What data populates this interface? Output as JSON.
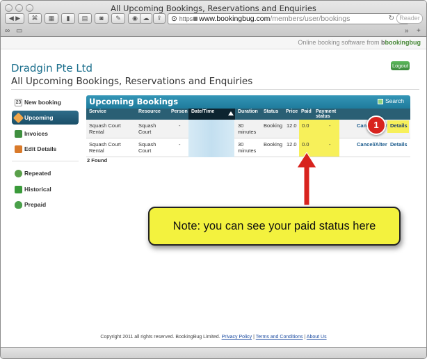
{
  "browser": {
    "window_title": "All Upcoming Bookings, Reservations and Enquiries",
    "url_scheme": "https",
    "url_host": "www.bookingbug.com",
    "url_path": "/members/user/bookings",
    "reader_label": "Reader",
    "overflow_label": "»",
    "add_label": "+"
  },
  "site_header": {
    "tagline": "Online booking software from",
    "brand_prefix": "b",
    "brand": "bookingbug"
  },
  "company_name": "Dradgin Pte Ltd",
  "logout_label": "Logout",
  "page_title": "All Upcoming Bookings, Reservations and Enquiries",
  "sidebar": {
    "items": [
      {
        "label": "New booking",
        "icon": "calendar-icon",
        "active": false
      },
      {
        "label": "Upcoming",
        "icon": "upcoming-icon",
        "active": true
      },
      {
        "label": "Invoices",
        "icon": "invoice-icon",
        "active": false
      },
      {
        "label": "Edit Details",
        "icon": "edit-icon",
        "active": false
      },
      {
        "label": "Repeated",
        "icon": "repeat-icon",
        "active": false
      },
      {
        "label": "Historical",
        "icon": "history-icon",
        "active": false
      },
      {
        "label": "Prepaid",
        "icon": "money-bag-icon",
        "active": false
      }
    ],
    "new_booking_day": "23"
  },
  "bookings": {
    "title": "Upcoming Bookings",
    "search_label": "Search",
    "columns": [
      "Service",
      "Resource",
      "Person",
      "Date/Time",
      "Duration",
      "Status",
      "Price",
      "Paid",
      "Payment status"
    ],
    "rows": [
      {
        "service": "Squash Court Rental",
        "resource": "Squash Court",
        "person": "-",
        "duration": "30 minutes",
        "status": "Booking",
        "price": "12.0",
        "paid": "0.0",
        "payment_status": "-",
        "action_cancel": "Cancel/Alter",
        "action_details": "Details"
      },
      {
        "service": "Squash Court Rental",
        "resource": "Squash Court",
        "person": "-",
        "duration": "30 minutes",
        "status": "Booking",
        "price": "12.0",
        "paid": "0.0",
        "payment_status": "-",
        "action_cancel": "Cancel/Alter",
        "action_details": "Details"
      }
    ],
    "found_text": "2 Found"
  },
  "annotation": {
    "badge_number": "1",
    "note_text": "Note: you can see your paid status here",
    "arrow_color": "#d8231e",
    "highlight_color": "#f7f05a"
  },
  "footer": {
    "copyright": "Copyright 2011 all rights reserved. BookingBug Limited.",
    "privacy": "Privacy Policy",
    "terms": "Terms and Conditions",
    "about": "About Us"
  }
}
